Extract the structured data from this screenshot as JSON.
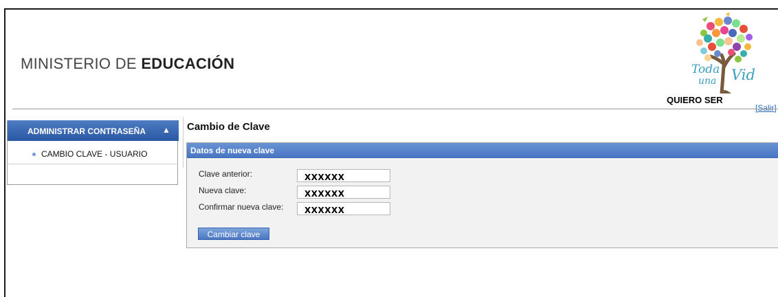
{
  "header": {
    "ministry_prefix": "MINISTERIO DE ",
    "ministry_bold": "EDUCACIÓN",
    "logo_text_1": "Toda",
    "logo_text_2": "una",
    "logo_text_3": "Vida",
    "tagline": "QUIERO SER",
    "logout_link": "[Salir]"
  },
  "sidebar": {
    "section_title": "ADMINISTRAR CONTRASEÑA",
    "collapse_icon": "chevron-up-icon",
    "items": [
      {
        "label": "CAMBIO CLAVE - USUARIO"
      }
    ]
  },
  "main": {
    "title": "Cambio de Clave",
    "panel_title": "Datos de nueva clave",
    "fields": [
      {
        "label": "Clave anterior:",
        "value": "XXXXXX"
      },
      {
        "label": "Nueva clave:",
        "value": "XXXXXX"
      },
      {
        "label": "Confirmar nueva clave:",
        "value": "XXXXXX"
      }
    ],
    "submit_label": "Cambiar clave"
  },
  "colors": {
    "accent_blue": "#2a58a4",
    "panel_bg": "#f2f2f2",
    "link": "#2a6fbf"
  }
}
